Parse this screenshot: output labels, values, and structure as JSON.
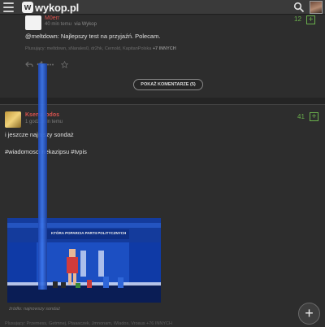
{
  "header": {
    "logo_text": "wykop.pl",
    "logo_badge": "w",
    "menu_icon": "hamburger-icon",
    "search_icon": "search-icon"
  },
  "entry1": {
    "author": "M0err",
    "time": "40 min temu",
    "via": "via Wykop",
    "score": "12",
    "plus": "+",
    "mention": "@meltdown:",
    "text": " Najlepszy test na przyjaźń. Polecam.",
    "plusers_prefix": "Plusujący: meltdown, sNarales0, dr2hk, Cernold, KapitanPolska",
    "plusers_more": "+7 INNYCH",
    "show_comments": "POKAŻ KOMENTARZE (5)"
  },
  "entry2": {
    "author": "Ksenu    lodos",
    "time": "1 godz.    min temu",
    "score": "41",
    "plus": "+",
    "text": "i jeszcze najn    szy sondaż",
    "tags": "#wiadomosci     nekazipsu #tvpis",
    "image_title": "KTÓRA POPARCIA PARTII POLITYCZNYCH",
    "caption": "źródło: najnowszy sondaż",
    "plusers": "Plusujący: Przemess, Getmnej, Ptaaaczek, Jmnonam, Wlados, Vroaus +76 INNYCH"
  },
  "fab": {
    "label": "+"
  },
  "colors": {
    "background": "#2b2b2b",
    "author_red": "#d9534f",
    "vote_green": "#6ab04c",
    "overlay_blue": "#3d78ee"
  }
}
